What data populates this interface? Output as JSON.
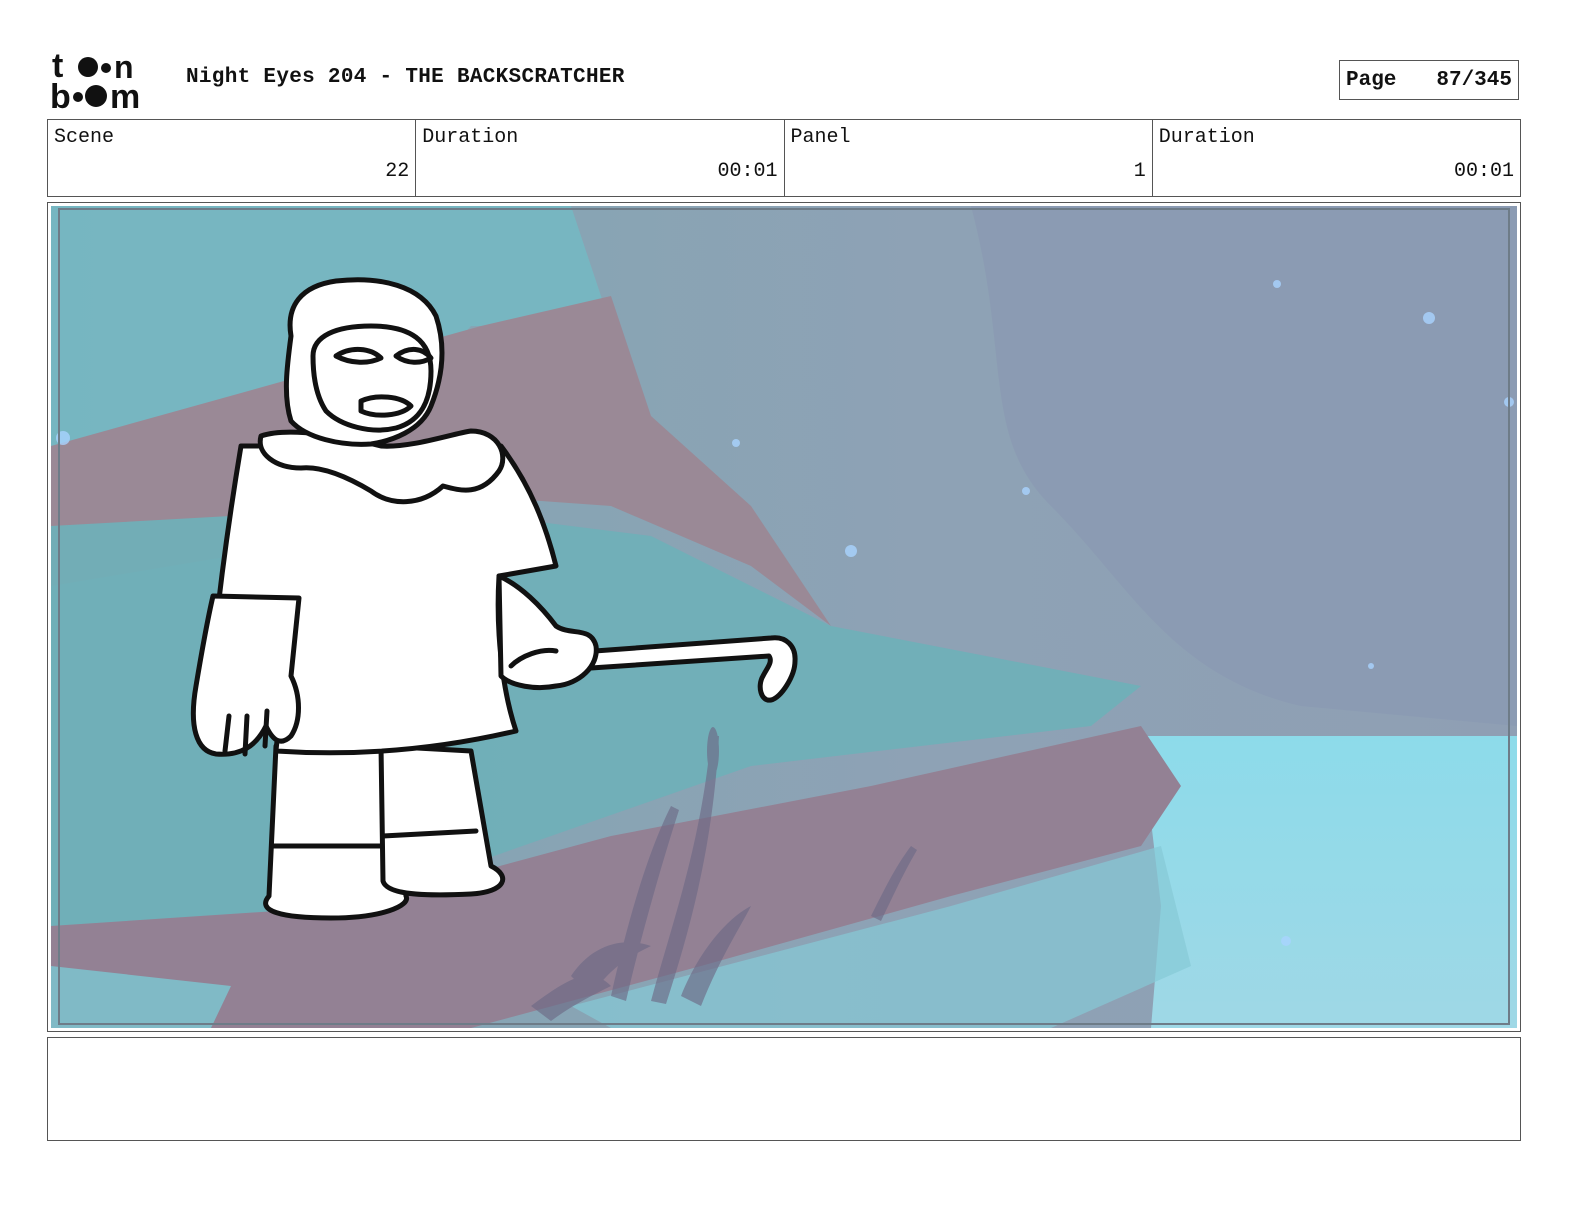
{
  "header": {
    "logo_text": "toon boom",
    "title": "Night Eyes 204 - THE BACKSCRATCHER",
    "page_label": "Page",
    "page_value": "87/345"
  },
  "info": {
    "scene_label": "Scene",
    "scene_value": "22",
    "scene_duration_label": "Duration",
    "scene_duration_value": "00:01",
    "panel_label": "Panel",
    "panel_value": "1",
    "panel_duration_label": "Duration",
    "panel_duration_value": "00:01"
  },
  "notes": {
    "text": ""
  },
  "colors": {
    "water_light": "#8fd9e8",
    "sky": "#8fa6b8",
    "cliff_mauve": "#9a8996",
    "teal": "#6fb6c2",
    "outline": "#111111"
  }
}
